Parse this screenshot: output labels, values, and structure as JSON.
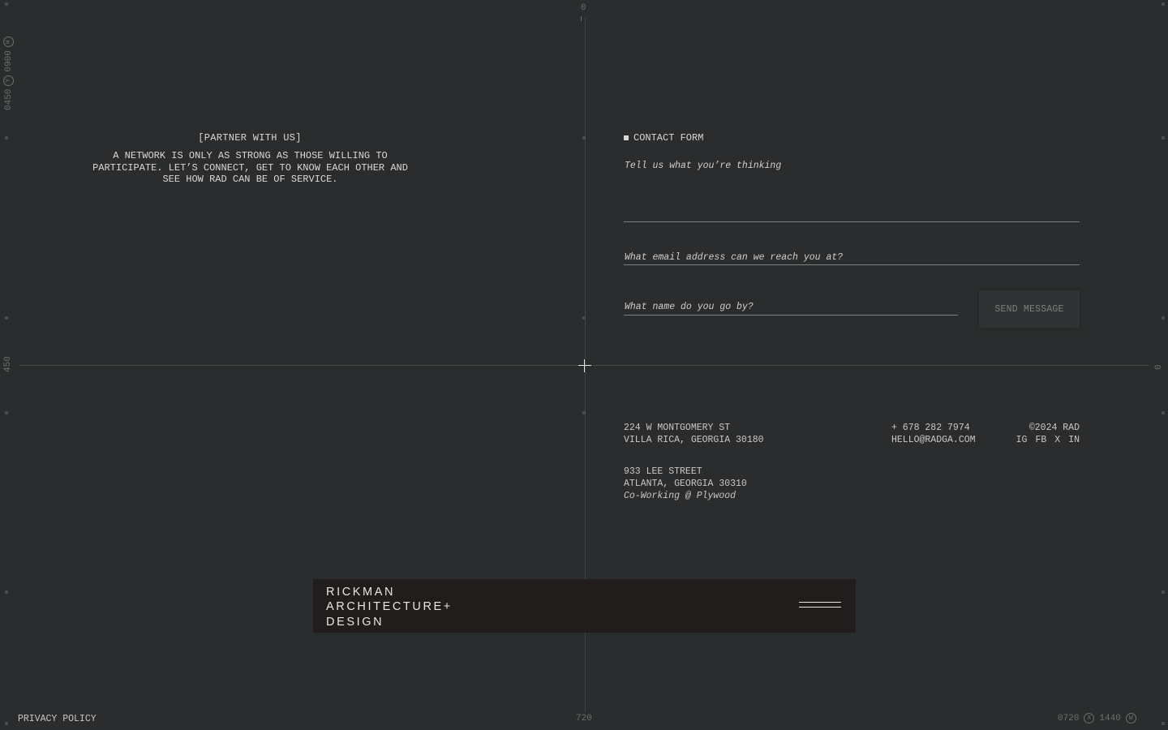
{
  "rulers": {
    "top": "0",
    "left_vertical": "0450",
    "left_vertical_2": "0900",
    "left_badge_y": "Y",
    "left_badge_h": "H",
    "left_mid": "450",
    "right_mid": "0",
    "bottom_center": "720",
    "bottom_right_x_value": "0720",
    "bottom_right_x_badge": "X",
    "bottom_right_w_value": "1440",
    "bottom_right_w_badge": "W"
  },
  "partner": {
    "title": "[PARTNER WITH US]",
    "body": "A NETWORK IS ONLY AS STRONG AS THOSE WILLING TO PARTICIPATE. LET’S CONNECT, GET TO KNOW EACH OTHER AND SEE HOW RAD CAN BE OF SERVICE."
  },
  "contact_form": {
    "label": "CONTACT FORM",
    "message_placeholder": "Tell us what you’re thinking",
    "email_placeholder": "What email address can we reach you at?",
    "name_placeholder": "What name do you go by?",
    "send_label": "SEND MESSAGE"
  },
  "footer_info": {
    "address1_line1": "224 W MONTGOMERY ST",
    "address1_line2": "VILLA RICA, GEORGIA 30180",
    "address2_line1": "933 LEE STREET",
    "address2_line2": "ATLANTA, GEORGIA 30310",
    "address2_note": "Co-Working @ Plywood",
    "phone": "+ 678 282 7974",
    "email": "HELLO@RADGA.COM",
    "copyright": "©2024 RAD",
    "socials": [
      "IG",
      "FB",
      "X",
      "IN"
    ]
  },
  "navbar": {
    "logo_line1": "RICKMAN",
    "logo_line2": "ARCHITECTURE+",
    "logo_line3": "DESIGN",
    "menu_icon": "hamburger-menu-icon"
  },
  "privacy_label": "PRIVACY POLICY",
  "colors": {
    "background": "#2a2c2d",
    "navbar": "#201d1c",
    "text": "#d9d9d4",
    "accent_line": "#3b5148"
  }
}
